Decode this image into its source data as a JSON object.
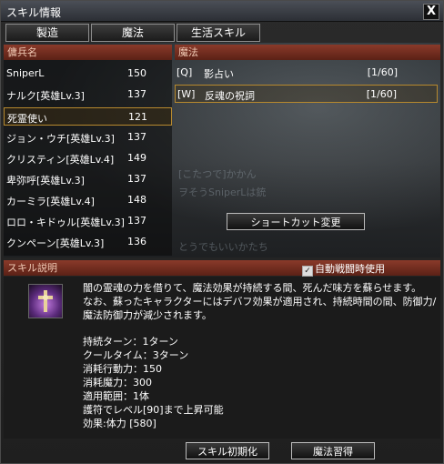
{
  "window": {
    "title": "スキル情報",
    "close_label": "X"
  },
  "tabs": [
    "製造",
    "魔法",
    "生活スキル"
  ],
  "mercenary_header": "傭兵名",
  "mercenaries": [
    {
      "name": "SniperL",
      "level": "150"
    },
    {
      "name": "ナルク[英雄Lv.3]",
      "level": "137"
    },
    {
      "name": "死霊使い",
      "level": "121"
    },
    {
      "name": "ジョン・ウチ[英雄Lv.3]",
      "level": "137"
    },
    {
      "name": "クリスティン[英雄Lv.4]",
      "level": "149"
    },
    {
      "name": "卑弥呼[英雄Lv.3]",
      "level": "137"
    },
    {
      "name": "カーミラ[英雄Lv.4]",
      "level": "148"
    },
    {
      "name": "ロロ・キドゥル[英雄Lv.3]",
      "level": "137"
    },
    {
      "name": "クンペーン[英雄Lv.3]",
      "level": "136"
    }
  ],
  "magic_header": "魔法",
  "magic": [
    {
      "key": "[Q]",
      "name": "影占い",
      "count": "[1/60]"
    },
    {
      "key": "[W]",
      "name": "反魂の祝詞",
      "count": "[1/60]"
    }
  ],
  "shortcut_button": "ショートカット変更",
  "skill_desc_header": "スキル説明",
  "auto_use_label": "自動戦闘時使用",
  "auto_use_checked": "✓",
  "description": [
    "闇の霊魂の力を借りて、魔法効果が持続する間、死んだ味方を蘇らせます。",
    "なお、蘇ったキャラクターにはデバフ効果が適用され、持続時間の間、防御力/",
    "魔法防御力が減少されます。"
  ],
  "stats": [
    "持続ターン：1ターン",
    "クールタイム：3ターン",
    "消耗行動力：150",
    "消耗魔力：300",
    "適用範囲：1体",
    "護符でレベル[90]まで上昇可能",
    "効果:体力 [580]"
  ],
  "buttons": {
    "reset": "スキル初期化",
    "learn": "魔法習得"
  },
  "background_text": [
    "とうでもいいかたち",
    "[こたつで]かかん",
    "ヲそうSniperLは銃"
  ],
  "colors": {
    "header": "#7a3020",
    "selection": "#b7892e"
  }
}
